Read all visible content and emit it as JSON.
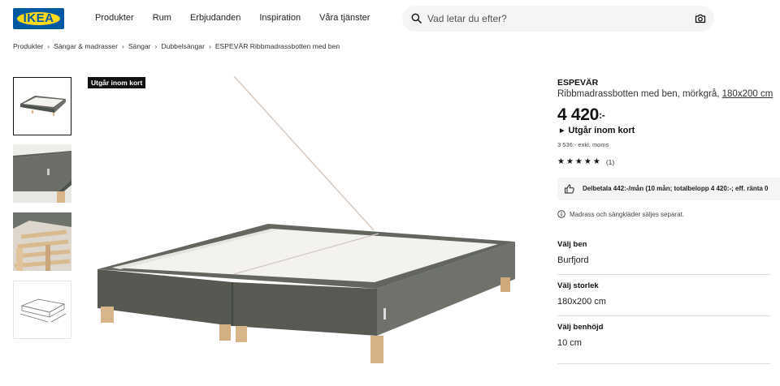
{
  "header": {
    "logo_text": "IKEA",
    "nav": [
      "Produkter",
      "Rum",
      "Erbjudanden",
      "Inspiration",
      "Våra tjänster"
    ],
    "search_placeholder": "Vad letar du efter?",
    "icons": [
      "search-icon",
      "camera-icon"
    ]
  },
  "breadcrumb": [
    "Produkter",
    "Sängar & madrasser",
    "Sängar",
    "Dubbelsängar",
    "ESPEVÄR Ribbmadrassbotten med ben"
  ],
  "gallery": {
    "badge": "Utgår inom kort",
    "thumbnails": [
      "bed-front-view",
      "bed-corner-closeup",
      "bed-slats-closeup",
      "bed-dimension-drawing"
    ],
    "selected_index": 0
  },
  "product": {
    "brand": "ESPEVÄR",
    "description": "Ribbmadrassbotten med ben, mörkgrå, ",
    "size_link": "180x200 cm",
    "price_main": "4 420",
    "price_suffix": ":-",
    "status": "Utgår inom kort",
    "ex_vat": "3 536:- exkl. moms",
    "stars": "★★★★★",
    "rating_value": 5,
    "rating_count": "(1)",
    "finance_text": "Delbetala 442:-/mån (10 mån; totalbelopp 4 420:-; eff. ränta 0",
    "note": "Madrass och sängkläder säljes separat."
  },
  "options": [
    {
      "label": "Välj ben",
      "value": "Burfjord"
    },
    {
      "label": "Välj storlek",
      "value": "180x200 cm"
    },
    {
      "label": "Välj benhöjd",
      "value": "10 cm"
    }
  ],
  "colors": {
    "ikea_blue": "#0058a3",
    "ikea_yellow": "#ffda1a",
    "fabric_grey": "#5f635c",
    "slat_white": "#f3f2ee",
    "leg_wood": "#d8b58a"
  }
}
